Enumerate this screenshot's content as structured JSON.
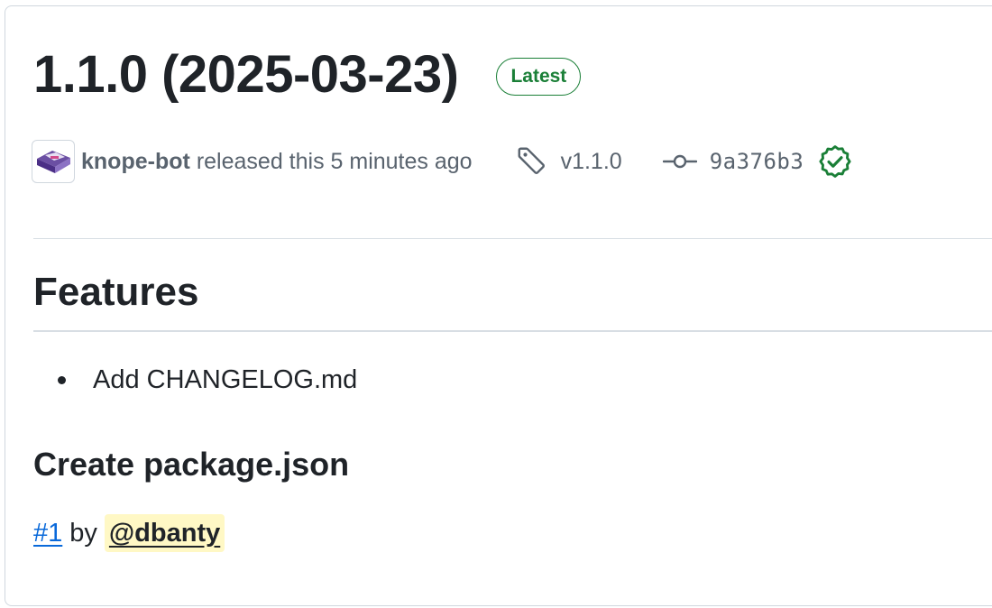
{
  "release": {
    "title": "1.1.0 (2025-03-23)",
    "badge": "Latest",
    "author": "knope-bot",
    "released_text": "released this 5 minutes ago",
    "tag": "v1.1.0",
    "commit": "9a376b3"
  },
  "body": {
    "features_heading": "Features",
    "features": [
      "Add CHANGELOG.md"
    ],
    "subheading": "Create package.json",
    "pr_link": "#1",
    "by_text": "by",
    "mention": "@dbanty"
  },
  "icons": {
    "tag": "tag-icon",
    "commit": "git-commit-icon",
    "verified": "verified-check-icon",
    "avatar": "knope-bot-avatar"
  },
  "colors": {
    "accent_green": "#1a7f37",
    "link_blue": "#0969da",
    "mention_bg": "#fff8c5",
    "muted_text": "#59636e"
  }
}
